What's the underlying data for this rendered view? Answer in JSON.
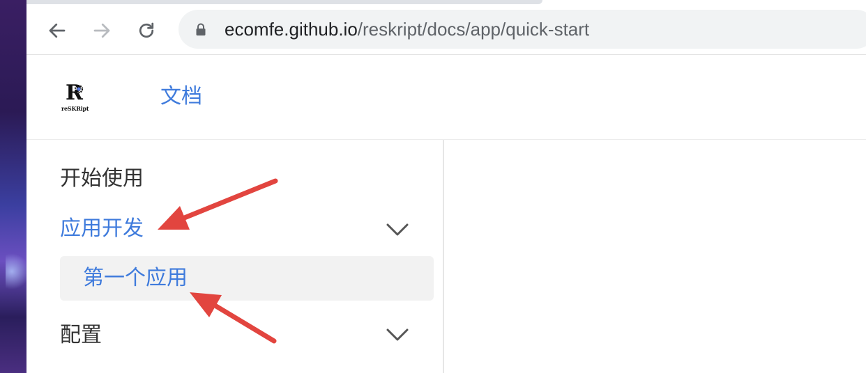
{
  "browser": {
    "url_host": "ecomfe.github.io",
    "url_path": "/reskript/docs/app/quick-start"
  },
  "site": {
    "logo_text": "reSKRipt",
    "nav_docs": "文档"
  },
  "sidebar": {
    "items": [
      {
        "label": "开始使用",
        "active": false
      },
      {
        "label": "应用开发",
        "active": true,
        "expanded": true,
        "children": [
          {
            "label": "第一个应用",
            "selected": true
          }
        ]
      },
      {
        "label": "配置",
        "active": false,
        "expanded": false
      }
    ]
  },
  "colors": {
    "accent": "#3f7bdc",
    "annotation_arrow": "#e2453f"
  }
}
